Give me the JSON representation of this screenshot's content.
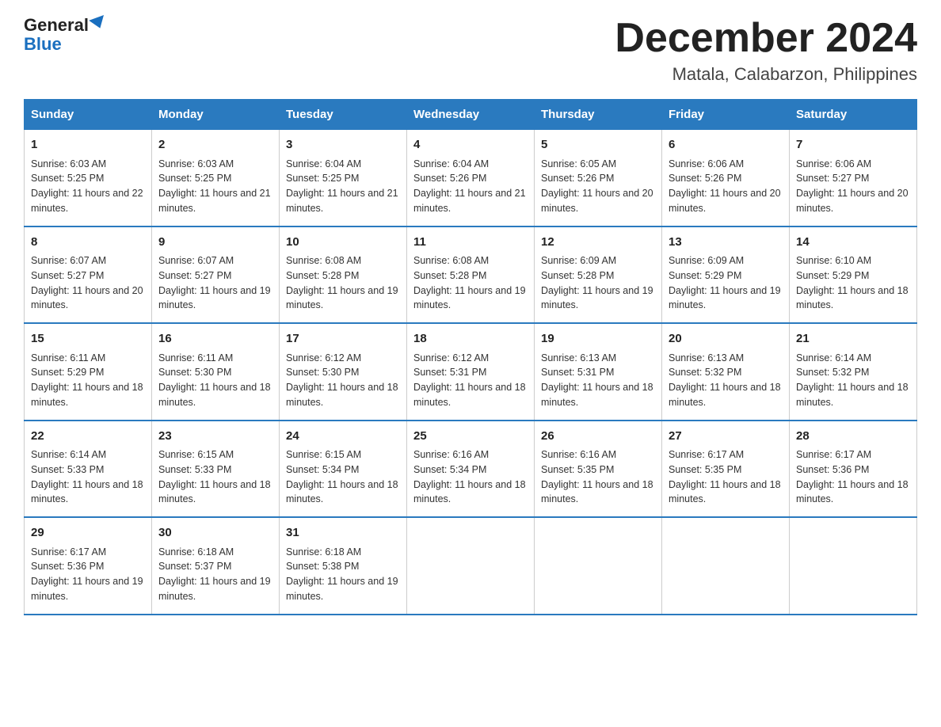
{
  "logo": {
    "general": "General",
    "blue": "Blue"
  },
  "title": {
    "month": "December 2024",
    "location": "Matala, Calabarzon, Philippines"
  },
  "days_of_week": [
    "Sunday",
    "Monday",
    "Tuesday",
    "Wednesday",
    "Thursday",
    "Friday",
    "Saturday"
  ],
  "weeks": [
    [
      {
        "day": "1",
        "info": "Sunrise: 6:03 AM\nSunset: 5:25 PM\nDaylight: 11 hours and 22 minutes."
      },
      {
        "day": "2",
        "info": "Sunrise: 6:03 AM\nSunset: 5:25 PM\nDaylight: 11 hours and 21 minutes."
      },
      {
        "day": "3",
        "info": "Sunrise: 6:04 AM\nSunset: 5:25 PM\nDaylight: 11 hours and 21 minutes."
      },
      {
        "day": "4",
        "info": "Sunrise: 6:04 AM\nSunset: 5:26 PM\nDaylight: 11 hours and 21 minutes."
      },
      {
        "day": "5",
        "info": "Sunrise: 6:05 AM\nSunset: 5:26 PM\nDaylight: 11 hours and 20 minutes."
      },
      {
        "day": "6",
        "info": "Sunrise: 6:06 AM\nSunset: 5:26 PM\nDaylight: 11 hours and 20 minutes."
      },
      {
        "day": "7",
        "info": "Sunrise: 6:06 AM\nSunset: 5:27 PM\nDaylight: 11 hours and 20 minutes."
      }
    ],
    [
      {
        "day": "8",
        "info": "Sunrise: 6:07 AM\nSunset: 5:27 PM\nDaylight: 11 hours and 20 minutes."
      },
      {
        "day": "9",
        "info": "Sunrise: 6:07 AM\nSunset: 5:27 PM\nDaylight: 11 hours and 19 minutes."
      },
      {
        "day": "10",
        "info": "Sunrise: 6:08 AM\nSunset: 5:28 PM\nDaylight: 11 hours and 19 minutes."
      },
      {
        "day": "11",
        "info": "Sunrise: 6:08 AM\nSunset: 5:28 PM\nDaylight: 11 hours and 19 minutes."
      },
      {
        "day": "12",
        "info": "Sunrise: 6:09 AM\nSunset: 5:28 PM\nDaylight: 11 hours and 19 minutes."
      },
      {
        "day": "13",
        "info": "Sunrise: 6:09 AM\nSunset: 5:29 PM\nDaylight: 11 hours and 19 minutes."
      },
      {
        "day": "14",
        "info": "Sunrise: 6:10 AM\nSunset: 5:29 PM\nDaylight: 11 hours and 18 minutes."
      }
    ],
    [
      {
        "day": "15",
        "info": "Sunrise: 6:11 AM\nSunset: 5:29 PM\nDaylight: 11 hours and 18 minutes."
      },
      {
        "day": "16",
        "info": "Sunrise: 6:11 AM\nSunset: 5:30 PM\nDaylight: 11 hours and 18 minutes."
      },
      {
        "day": "17",
        "info": "Sunrise: 6:12 AM\nSunset: 5:30 PM\nDaylight: 11 hours and 18 minutes."
      },
      {
        "day": "18",
        "info": "Sunrise: 6:12 AM\nSunset: 5:31 PM\nDaylight: 11 hours and 18 minutes."
      },
      {
        "day": "19",
        "info": "Sunrise: 6:13 AM\nSunset: 5:31 PM\nDaylight: 11 hours and 18 minutes."
      },
      {
        "day": "20",
        "info": "Sunrise: 6:13 AM\nSunset: 5:32 PM\nDaylight: 11 hours and 18 minutes."
      },
      {
        "day": "21",
        "info": "Sunrise: 6:14 AM\nSunset: 5:32 PM\nDaylight: 11 hours and 18 minutes."
      }
    ],
    [
      {
        "day": "22",
        "info": "Sunrise: 6:14 AM\nSunset: 5:33 PM\nDaylight: 11 hours and 18 minutes."
      },
      {
        "day": "23",
        "info": "Sunrise: 6:15 AM\nSunset: 5:33 PM\nDaylight: 11 hours and 18 minutes."
      },
      {
        "day": "24",
        "info": "Sunrise: 6:15 AM\nSunset: 5:34 PM\nDaylight: 11 hours and 18 minutes."
      },
      {
        "day": "25",
        "info": "Sunrise: 6:16 AM\nSunset: 5:34 PM\nDaylight: 11 hours and 18 minutes."
      },
      {
        "day": "26",
        "info": "Sunrise: 6:16 AM\nSunset: 5:35 PM\nDaylight: 11 hours and 18 minutes."
      },
      {
        "day": "27",
        "info": "Sunrise: 6:17 AM\nSunset: 5:35 PM\nDaylight: 11 hours and 18 minutes."
      },
      {
        "day": "28",
        "info": "Sunrise: 6:17 AM\nSunset: 5:36 PM\nDaylight: 11 hours and 18 minutes."
      }
    ],
    [
      {
        "day": "29",
        "info": "Sunrise: 6:17 AM\nSunset: 5:36 PM\nDaylight: 11 hours and 19 minutes."
      },
      {
        "day": "30",
        "info": "Sunrise: 6:18 AM\nSunset: 5:37 PM\nDaylight: 11 hours and 19 minutes."
      },
      {
        "day": "31",
        "info": "Sunrise: 6:18 AM\nSunset: 5:38 PM\nDaylight: 11 hours and 19 minutes."
      },
      {
        "day": "",
        "info": ""
      },
      {
        "day": "",
        "info": ""
      },
      {
        "day": "",
        "info": ""
      },
      {
        "day": "",
        "info": ""
      }
    ]
  ]
}
